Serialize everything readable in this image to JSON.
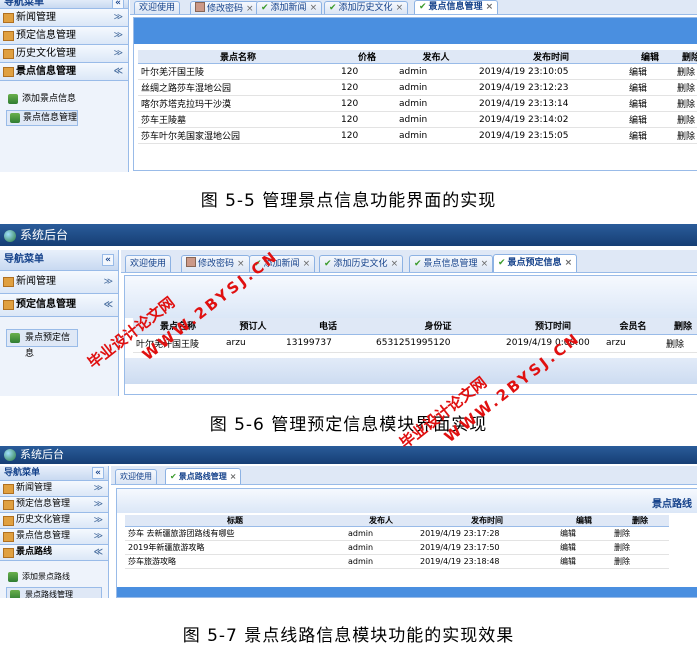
{
  "screens": {
    "s1": {
      "sidebar": {
        "header": "导航菜单",
        "items": [
          "新闻管理",
          "预定信息管理",
          "历史文化管理",
          "景点信息管理"
        ],
        "subitems": [
          "添加景点信息",
          "景点信息管理"
        ]
      },
      "tabs": [
        "欢迎使用",
        "修改密码",
        "添加新闻",
        "添加历史文化",
        "景点信息管理"
      ],
      "columns": [
        "景点名称",
        "价格",
        "发布人",
        "发布时间",
        "编辑",
        "删除"
      ],
      "rows": [
        [
          "叶尔羌汗国王陵",
          "120",
          "admin",
          "2019/4/19 23:10:05",
          "编辑",
          "删除"
        ],
        [
          "丝绸之路莎车湿地公园",
          "120",
          "admin",
          "2019/4/19 23:12:23",
          "编辑",
          "删除"
        ],
        [
          "喀尔苏塔克拉玛干沙漠",
          "120",
          "admin",
          "2019/4/19 23:13:14",
          "编辑",
          "删除"
        ],
        [
          "莎车王陵墓",
          "120",
          "admin",
          "2019/4/19 23:14:02",
          "编辑",
          "删除"
        ],
        [
          "莎车叶尔羌国家湿地公园",
          "120",
          "admin",
          "2019/4/19 23:15:05",
          "编辑",
          "删除"
        ]
      ]
    },
    "caption1": "图 5-5  管理景点信息功能界面的实现",
    "s2": {
      "app_title": "系统后台",
      "sidebar": {
        "header": "导航菜单",
        "items": [
          "新闻管理",
          "预定信息管理"
        ],
        "subitems": [
          "景点预定信息"
        ]
      },
      "tabs": [
        "欢迎使用",
        "修改密码",
        "添加新闻",
        "添加历史文化",
        "景点信息管理",
        "景点预定信息"
      ],
      "columns": [
        "景点名称",
        "预订人",
        "电话",
        "身份证",
        "预订时间",
        "会员名",
        "删除"
      ],
      "rows": [
        [
          "叶尔羌汗国王陵",
          "arzu",
          "13199737",
          "6531251995120",
          "2019/4/19 0:00:00",
          "arzu",
          "删除"
        ]
      ]
    },
    "caption2": "图 5-6  管理预定信息模块界面实现",
    "s3": {
      "app_title": "系统后台",
      "sidebar": {
        "header": "导航菜单",
        "items": [
          "新闻管理",
          "预定信息管理",
          "历史文化管理",
          "景点信息管理",
          "景点路线"
        ],
        "subitems": [
          "添加景点路线",
          "景点路线管理"
        ]
      },
      "tabs": [
        "欢迎使用",
        "景点路线管理"
      ],
      "panel_title": "景点路线",
      "columns": [
        "标题",
        "发布人",
        "发布时间",
        "编辑",
        "删除"
      ],
      "rows": [
        [
          "莎车 去新疆旅游团路线有哪些",
          "admin",
          "2019/4/19 23:17:28",
          "编辑",
          "删除"
        ],
        [
          "2019年新疆旅游攻略",
          "admin",
          "2019/4/19 23:17:50",
          "编辑",
          "删除"
        ],
        [
          "莎车旅游攻略",
          "admin",
          "2019/4/19 23:18:48",
          "编辑",
          "删除"
        ]
      ]
    },
    "caption3": "图 5-7  景点线路信息模块功能的实现效果"
  },
  "watermark": {
    "line1": "毕业设计论文网",
    "line2": "WWW.2BYSJ.CN"
  },
  "colors": {
    "header_blue": "#1e4e8c",
    "band_blue": "#4a8fe0",
    "grid_header": "#dfe8f6",
    "border_blue": "#99bbe8",
    "watermark_red": "#e01010"
  }
}
